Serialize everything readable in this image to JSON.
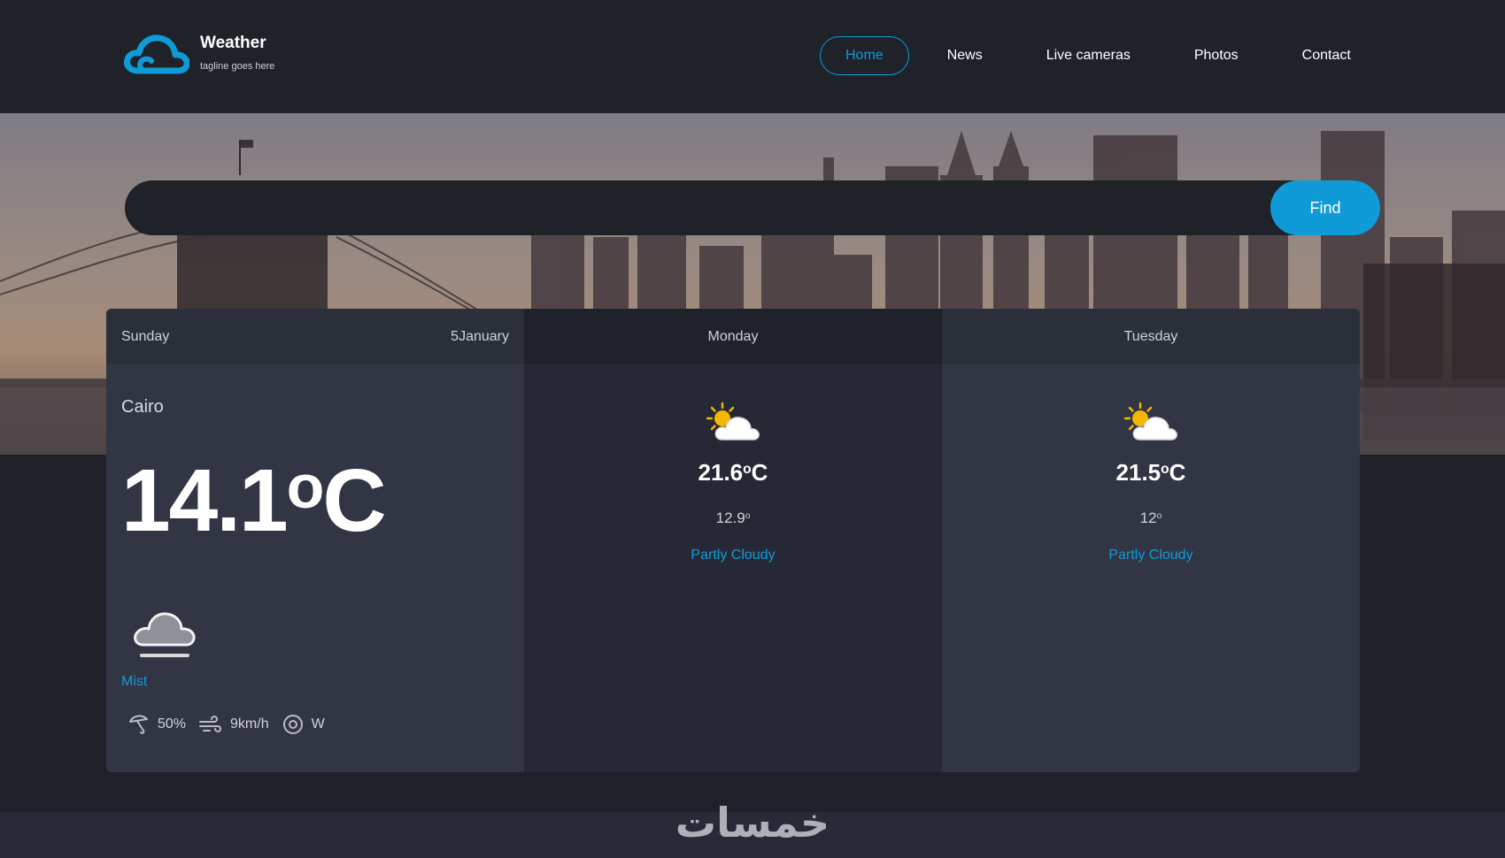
{
  "brand": {
    "name": "Weather",
    "tagline": "tagline goes here",
    "accent_color": "#0f9bd8"
  },
  "nav": {
    "items": [
      {
        "label": "Home",
        "active": true
      },
      {
        "label": "News",
        "active": false
      },
      {
        "label": "Live cameras",
        "active": false
      },
      {
        "label": "Photos",
        "active": false
      },
      {
        "label": "Contact",
        "active": false
      }
    ]
  },
  "search": {
    "value": "",
    "placeholder": "",
    "button_label": "Find"
  },
  "forecast": {
    "today": {
      "day": "Sunday",
      "date": "5January",
      "location": "Cairo",
      "temperature": "14.1",
      "temp_unit": "o",
      "temp_suffix": "C",
      "icon": "mist-cloud-icon",
      "condition": "Mist",
      "humidity": "50%",
      "wind_speed": "9km/h",
      "wind_direction": "W"
    },
    "days": [
      {
        "day": "Monday",
        "icon": "partly-cloudy-icon",
        "max": "21.6",
        "max_unit": "o",
        "max_suffix": "C",
        "min": "12.9",
        "min_unit": "o",
        "condition": "Partly Cloudy"
      },
      {
        "day": "Tuesday",
        "icon": "partly-cloudy-icon",
        "max": "21.5",
        "max_unit": "o",
        "max_suffix": "C",
        "min": "12",
        "min_unit": "o",
        "condition": "Partly Cloudy"
      }
    ]
  },
  "footer": {
    "watermark": "خمسات"
  }
}
